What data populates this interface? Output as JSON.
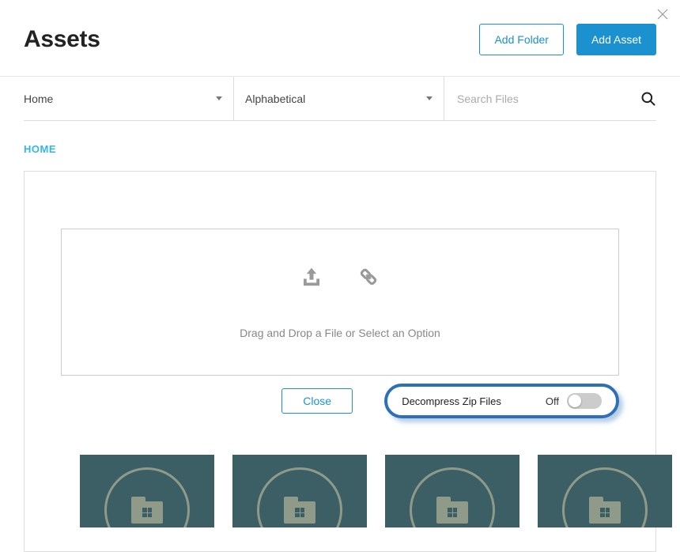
{
  "header": {
    "title": "Assets",
    "add_folder_label": "Add Folder",
    "add_asset_label": "Add Asset"
  },
  "filter_bar": {
    "location": "Home",
    "sort": "Alphabetical",
    "search_placeholder": "Search Files"
  },
  "breadcrumb": {
    "home": "HOME"
  },
  "dropzone": {
    "text": "Drag and Drop a File or Select an Option",
    "close_label": "Close"
  },
  "toggle": {
    "label": "Decompress Zip Files",
    "state": "Off"
  }
}
